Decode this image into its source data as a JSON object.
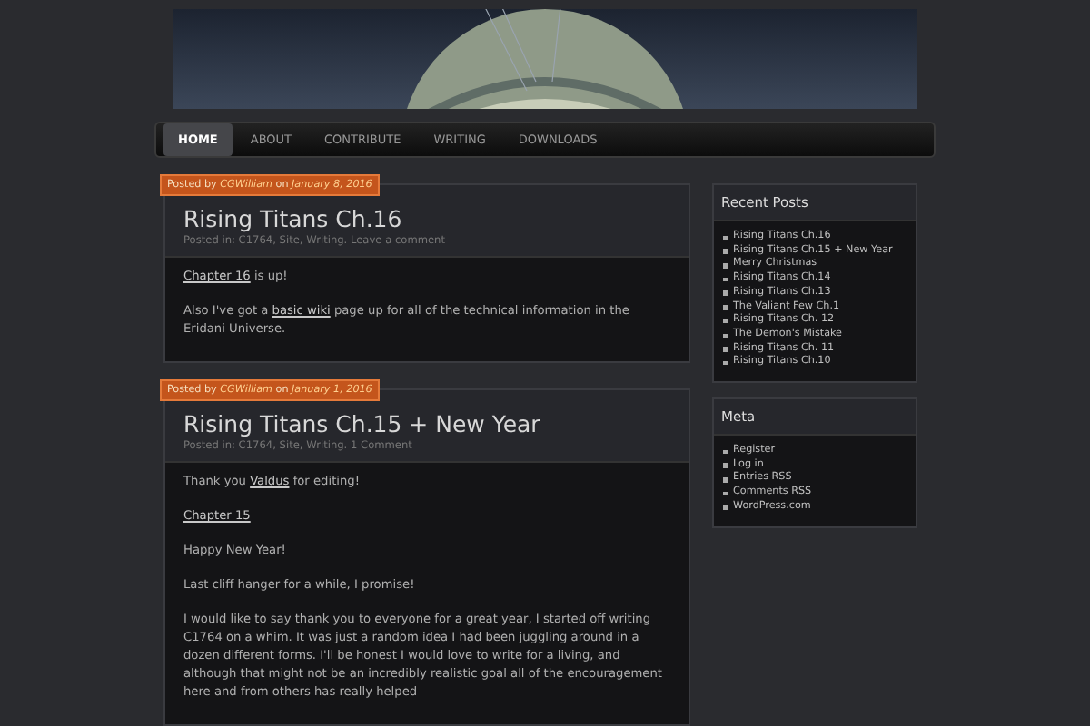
{
  "nav": {
    "items": [
      {
        "label": "HOME",
        "selected": true
      },
      {
        "label": "ABOUT",
        "selected": false
      },
      {
        "label": "CONTRIBUTE",
        "selected": false
      },
      {
        "label": "WRITING",
        "selected": false
      },
      {
        "label": "DOWNLOADS",
        "selected": false
      }
    ]
  },
  "posts": [
    {
      "posted_by": "Posted by",
      "author": "CGWilliam",
      "on": "on",
      "date": "January 8, 2016",
      "title": "Rising Titans Ch.16",
      "meta": "Posted in: C1764, Site, Writing. Leave a comment",
      "paragraphs": [
        [
          {
            "text": "Chapter 16",
            "link": true
          },
          {
            "text": " is up!",
            "link": false
          }
        ],
        [
          {
            "text": "Also I've got a ",
            "link": false
          },
          {
            "text": "basic wiki",
            "link": true
          },
          {
            "text": " page up for all of the technical information in the Eridani Universe.",
            "link": false
          }
        ]
      ]
    },
    {
      "posted_by": "Posted by",
      "author": "CGWilliam",
      "on": "on",
      "date": "January 1, 2016",
      "title": "Rising Titans Ch.15 + New Year",
      "meta": "Posted in: C1764, Site, Writing. 1 Comment",
      "paragraphs": [
        [
          {
            "text": "Thank you ",
            "link": false
          },
          {
            "text": "Valdus",
            "link": true
          },
          {
            "text": " for editing!",
            "link": false
          }
        ],
        [
          {
            "text": "Chapter 15",
            "link": true
          }
        ],
        [
          {
            "text": "Happy New Year!",
            "link": false
          }
        ],
        [
          {
            "text": "Last cliff hanger for a while, I promise!",
            "link": false
          }
        ],
        [
          {
            "text": "I would like to say thank you to everyone for a great year, I started off writing C1764 on a whim. It was just a random idea I had been juggling around in a dozen different forms. I'll be honest I would love to write for a living, and although that might not be an incredibly realistic goal all of the encouragement here and from others has really helped",
            "link": false
          }
        ]
      ]
    }
  ],
  "sidebar": [
    {
      "title": "Recent Posts",
      "items": [
        "Rising Titans Ch.16",
        "Rising Titans Ch.15 + New Year",
        "Merry Christmas",
        "Rising Titans Ch.14",
        "Rising Titans Ch.13",
        "The Valiant Few Ch.1",
        "Rising Titans Ch. 12",
        "The Demon's Mistake",
        "Rising Titans Ch. 11",
        "Rising Titans Ch.10"
      ]
    },
    {
      "title": "Meta",
      "items": [
        "Register",
        "Log in",
        "Entries RSS",
        "Comments RSS",
        "WordPress.com"
      ]
    }
  ]
}
